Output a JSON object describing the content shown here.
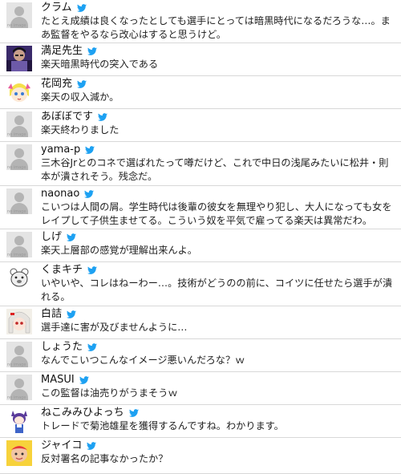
{
  "theme": {
    "bird_color": "#1da1f2",
    "border_color": "#d8d8d8"
  },
  "avatar_placeholder_text": "no image",
  "tweets": [
    {
      "name": "クラム",
      "avatar": "no-image",
      "text": "たとえ成績は良くなったとしても選手にとっては暗黒時代になるだろうな…。まあ監督をやるなら改心はすると思うけど。"
    },
    {
      "name": "満足先生",
      "avatar": "photo-dark-figure",
      "text": "楽天暗黒時代の突入である"
    },
    {
      "name": "花岡充",
      "avatar": "anime-yellow",
      "text": "楽天の収入減か。"
    },
    {
      "name": "あぼぼです",
      "avatar": "no-image",
      "text": "楽天終わりました"
    },
    {
      "name": "yama-p",
      "avatar": "no-image",
      "text": "三木谷Jrとのコネで選ばれたって噂だけど、これで中日の浅尾みたいに松井・則本が潰されそう。残念だ。"
    },
    {
      "name": "naonao",
      "avatar": "no-image",
      "text": "こいつは人間の屑。学生時代は後輩の彼女を無理やり犯し、大人になっても女をレイプして子供生ませてる。こういう奴を平気で雇ってる楽天は異常だわ。"
    },
    {
      "name": "しげ",
      "avatar": "no-image",
      "text": "楽天上層部の感覚が理解出来んよ。"
    },
    {
      "name": "くまキチ",
      "avatar": "sketch-bear",
      "text": "いやいや、コレはねーわー…。技術がどうのの前に、コイツに任せたら選手が潰れる。"
    },
    {
      "name": "白詰",
      "avatar": "anime-white-hair",
      "text": "選手達に害が及びませんように…"
    },
    {
      "name": "しょうた",
      "avatar": "no-image",
      "text": "なんでこいつこんなイメージ悪いんだろな？ｗ"
    },
    {
      "name": "MASUI",
      "avatar": "no-image",
      "text": "この監督は油売りがうまそうｗ"
    },
    {
      "name": "ねこみみひよっち",
      "avatar": "anime-catgirl",
      "text": "トレードで菊池雄星を獲得するんですね。わかります。"
    },
    {
      "name": "ジャイコ",
      "avatar": "baby-photo",
      "text": "反対署名の記事なかったか？"
    }
  ]
}
